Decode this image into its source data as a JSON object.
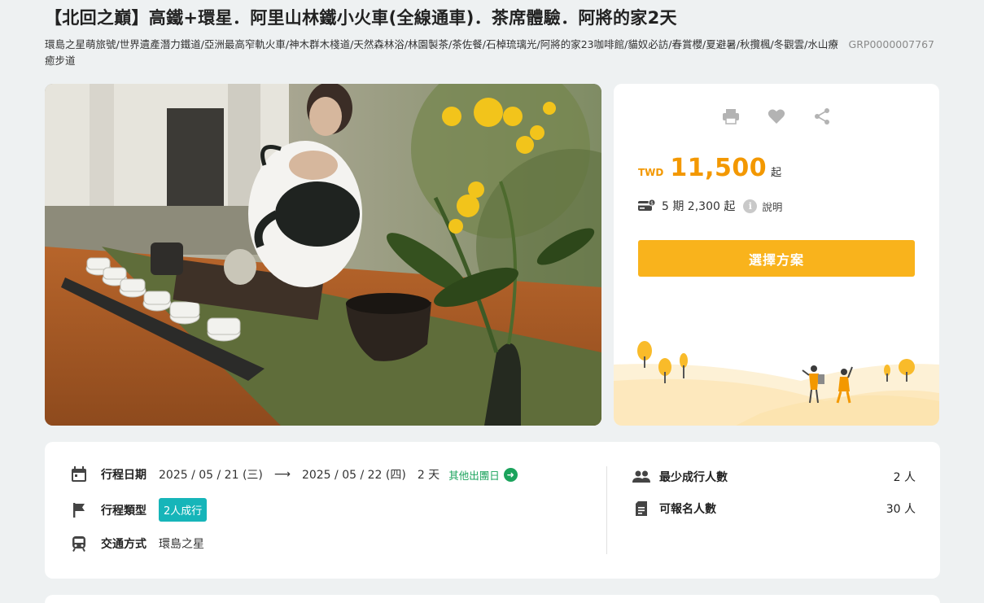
{
  "tour": {
    "title": "【北回之巔】高鐵+環星．阿里山林鐵小火車(全線通車)．茶席體驗．阿將的家2天",
    "tags": "環島之星萌旅號/世界遺產潛力鐵道/亞洲最高窄軌火車/神木群木棧道/天然森林浴/林園製茶/茶佐餐/石棹琉璃光/阿將的家23咖啡館/貓奴必訪/春賞櫻/夏避暑/秋攬楓/冬觀雲/水山療癒步道",
    "code": "GRP0000007767",
    "hero_image_alt": "tea-ceremony-photo"
  },
  "pricing": {
    "actions": [
      {
        "name": "print-icon"
      },
      {
        "name": "heart-icon"
      },
      {
        "name": "share-icon"
      }
    ],
    "currency": "TWD",
    "amount": "11,500",
    "from_suffix": "起",
    "installment_text": "5 期 2,300 起",
    "info_glyph": "i",
    "explain_label": "說明",
    "select_button_label": "選擇方案"
  },
  "details": {
    "date": {
      "label": "行程日期",
      "start": "2025 / 05 / 21 (三)",
      "arrow": "⟶",
      "end": "2025 / 05 / 22 (四)",
      "days": "2 天",
      "other_dates_label": "其他出團日"
    },
    "type": {
      "label": "行程類型",
      "badge": "2人成行"
    },
    "transport": {
      "label": "交通方式",
      "value": "環島之星"
    },
    "min_people": {
      "label": "最少成行人數",
      "value": "2 人"
    },
    "capacity": {
      "label": "可報名人數",
      "value": "30 人"
    }
  },
  "colors": {
    "accent_orange": "#f39800",
    "button_yellow": "#f9b31c",
    "badge_teal": "#16b5b9",
    "link_green": "#1ba35c"
  }
}
